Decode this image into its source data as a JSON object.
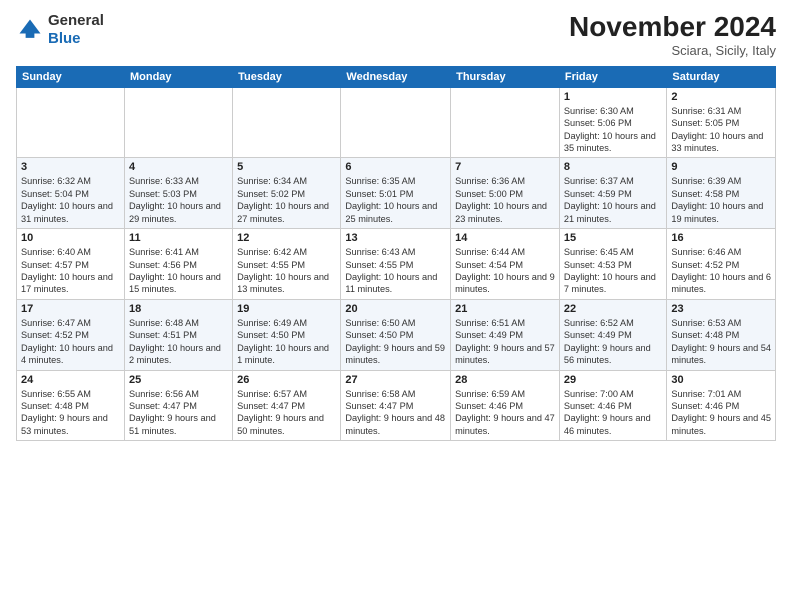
{
  "logo": {
    "general": "General",
    "blue": "Blue"
  },
  "title": "November 2024",
  "subtitle": "Sciara, Sicily, Italy",
  "days_of_week": [
    "Sunday",
    "Monday",
    "Tuesday",
    "Wednesday",
    "Thursday",
    "Friday",
    "Saturday"
  ],
  "weeks": [
    [
      {
        "day": "",
        "detail": ""
      },
      {
        "day": "",
        "detail": ""
      },
      {
        "day": "",
        "detail": ""
      },
      {
        "day": "",
        "detail": ""
      },
      {
        "day": "",
        "detail": ""
      },
      {
        "day": "1",
        "detail": "Sunrise: 6:30 AM\nSunset: 5:06 PM\nDaylight: 10 hours and 35 minutes."
      },
      {
        "day": "2",
        "detail": "Sunrise: 6:31 AM\nSunset: 5:05 PM\nDaylight: 10 hours and 33 minutes."
      }
    ],
    [
      {
        "day": "3",
        "detail": "Sunrise: 6:32 AM\nSunset: 5:04 PM\nDaylight: 10 hours and 31 minutes."
      },
      {
        "day": "4",
        "detail": "Sunrise: 6:33 AM\nSunset: 5:03 PM\nDaylight: 10 hours and 29 minutes."
      },
      {
        "day": "5",
        "detail": "Sunrise: 6:34 AM\nSunset: 5:02 PM\nDaylight: 10 hours and 27 minutes."
      },
      {
        "day": "6",
        "detail": "Sunrise: 6:35 AM\nSunset: 5:01 PM\nDaylight: 10 hours and 25 minutes."
      },
      {
        "day": "7",
        "detail": "Sunrise: 6:36 AM\nSunset: 5:00 PM\nDaylight: 10 hours and 23 minutes."
      },
      {
        "day": "8",
        "detail": "Sunrise: 6:37 AM\nSunset: 4:59 PM\nDaylight: 10 hours and 21 minutes."
      },
      {
        "day": "9",
        "detail": "Sunrise: 6:39 AM\nSunset: 4:58 PM\nDaylight: 10 hours and 19 minutes."
      }
    ],
    [
      {
        "day": "10",
        "detail": "Sunrise: 6:40 AM\nSunset: 4:57 PM\nDaylight: 10 hours and 17 minutes."
      },
      {
        "day": "11",
        "detail": "Sunrise: 6:41 AM\nSunset: 4:56 PM\nDaylight: 10 hours and 15 minutes."
      },
      {
        "day": "12",
        "detail": "Sunrise: 6:42 AM\nSunset: 4:55 PM\nDaylight: 10 hours and 13 minutes."
      },
      {
        "day": "13",
        "detail": "Sunrise: 6:43 AM\nSunset: 4:55 PM\nDaylight: 10 hours and 11 minutes."
      },
      {
        "day": "14",
        "detail": "Sunrise: 6:44 AM\nSunset: 4:54 PM\nDaylight: 10 hours and 9 minutes."
      },
      {
        "day": "15",
        "detail": "Sunrise: 6:45 AM\nSunset: 4:53 PM\nDaylight: 10 hours and 7 minutes."
      },
      {
        "day": "16",
        "detail": "Sunrise: 6:46 AM\nSunset: 4:52 PM\nDaylight: 10 hours and 6 minutes."
      }
    ],
    [
      {
        "day": "17",
        "detail": "Sunrise: 6:47 AM\nSunset: 4:52 PM\nDaylight: 10 hours and 4 minutes."
      },
      {
        "day": "18",
        "detail": "Sunrise: 6:48 AM\nSunset: 4:51 PM\nDaylight: 10 hours and 2 minutes."
      },
      {
        "day": "19",
        "detail": "Sunrise: 6:49 AM\nSunset: 4:50 PM\nDaylight: 10 hours and 1 minute."
      },
      {
        "day": "20",
        "detail": "Sunrise: 6:50 AM\nSunset: 4:50 PM\nDaylight: 9 hours and 59 minutes."
      },
      {
        "day": "21",
        "detail": "Sunrise: 6:51 AM\nSunset: 4:49 PM\nDaylight: 9 hours and 57 minutes."
      },
      {
        "day": "22",
        "detail": "Sunrise: 6:52 AM\nSunset: 4:49 PM\nDaylight: 9 hours and 56 minutes."
      },
      {
        "day": "23",
        "detail": "Sunrise: 6:53 AM\nSunset: 4:48 PM\nDaylight: 9 hours and 54 minutes."
      }
    ],
    [
      {
        "day": "24",
        "detail": "Sunrise: 6:55 AM\nSunset: 4:48 PM\nDaylight: 9 hours and 53 minutes."
      },
      {
        "day": "25",
        "detail": "Sunrise: 6:56 AM\nSunset: 4:47 PM\nDaylight: 9 hours and 51 minutes."
      },
      {
        "day": "26",
        "detail": "Sunrise: 6:57 AM\nSunset: 4:47 PM\nDaylight: 9 hours and 50 minutes."
      },
      {
        "day": "27",
        "detail": "Sunrise: 6:58 AM\nSunset: 4:47 PM\nDaylight: 9 hours and 48 minutes."
      },
      {
        "day": "28",
        "detail": "Sunrise: 6:59 AM\nSunset: 4:46 PM\nDaylight: 9 hours and 47 minutes."
      },
      {
        "day": "29",
        "detail": "Sunrise: 7:00 AM\nSunset: 4:46 PM\nDaylight: 9 hours and 46 minutes."
      },
      {
        "day": "30",
        "detail": "Sunrise: 7:01 AM\nSunset: 4:46 PM\nDaylight: 9 hours and 45 minutes."
      }
    ]
  ]
}
